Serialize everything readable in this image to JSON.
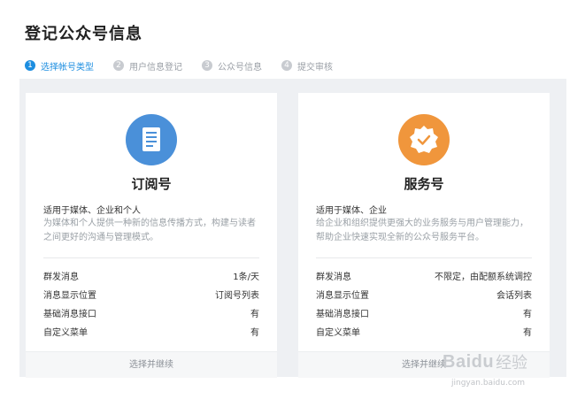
{
  "page": {
    "title": "登记公众号信息"
  },
  "steps": [
    {
      "num": "1",
      "label": "选择帐号类型",
      "active": true
    },
    {
      "num": "2",
      "label": "用户信息登记",
      "active": false
    },
    {
      "num": "3",
      "label": "公众号信息",
      "active": false
    },
    {
      "num": "4",
      "label": "提交审核",
      "active": false
    }
  ],
  "cards": [
    {
      "name": "订阅号",
      "icon": "document-icon",
      "icon_color": "#4a90d9",
      "suitable": "适用于媒体、企业和个人",
      "description": "为媒体和个人提供一种新的信息传播方式，构建与读者之间更好的沟通与管理模式。",
      "features": [
        {
          "label": "群发消息",
          "value": "1条/天"
        },
        {
          "label": "消息显示位置",
          "value": "订阅号列表"
        },
        {
          "label": "基础消息接口",
          "value": "有"
        },
        {
          "label": "自定义菜单",
          "value": "有"
        }
      ],
      "action": "选择并继续"
    },
    {
      "name": "服务号",
      "icon": "verified-badge-icon",
      "icon_color": "#f0963c",
      "suitable": "适用于媒体、企业",
      "description": "给企业和组织提供更强大的业务服务与用户管理能力，帮助企业快速实现全新的公众号服务平台。",
      "features": [
        {
          "label": "群发消息",
          "value": "不限定，由配额系统调控"
        },
        {
          "label": "消息显示位置",
          "value": "会话列表"
        },
        {
          "label": "基础消息接口",
          "value": "有"
        },
        {
          "label": "自定义菜单",
          "value": "有"
        }
      ],
      "action": "选择并继续"
    }
  ],
  "watermark": {
    "brand": "Baidu",
    "cn": "经验",
    "url": "jingyan.baidu.com"
  }
}
